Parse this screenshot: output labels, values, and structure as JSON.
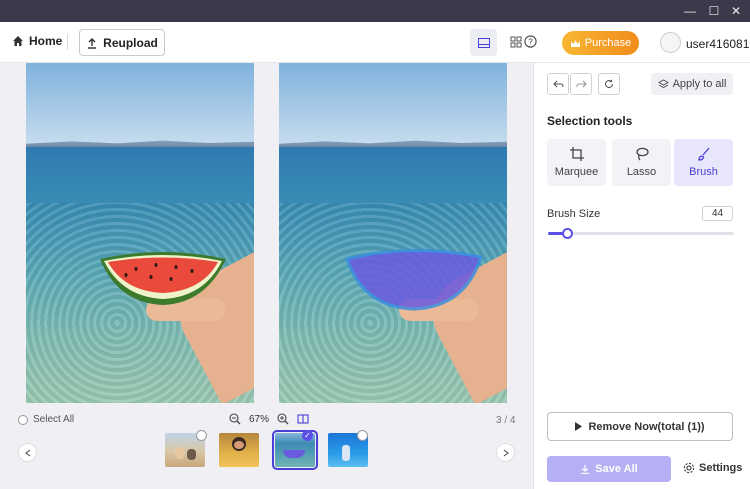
{
  "titlebar": {
    "minimize": "—",
    "maximize": "☐",
    "close": "✕"
  },
  "header": {
    "home_label": "Home",
    "reupload_label": "Reupload",
    "purchase_label": "Purchase",
    "username": "user416081"
  },
  "canvas": {
    "select_all_label": "Select All",
    "zoom_level": "67%",
    "page_counter": "3 / 4",
    "thumbnails": [
      {
        "name": "thumb-people-beach",
        "selected": false
      },
      {
        "name": "thumb-person-desert",
        "selected": false
      },
      {
        "name": "thumb-watermelon-sea",
        "selected": true
      },
      {
        "name": "thumb-diver-underwater",
        "selected": false
      }
    ]
  },
  "panel": {
    "apply_to_all_label": "Apply to all",
    "section_title": "Selection tools",
    "tools": [
      {
        "label": "Marquee",
        "icon": "crop-icon",
        "active": false
      },
      {
        "label": "Lasso",
        "icon": "lasso-icon",
        "active": false
      },
      {
        "label": "Brush",
        "icon": "brush-icon",
        "active": true
      }
    ],
    "brush_size_label": "Brush Size",
    "brush_size_value": "44",
    "brush_size_fraction": 0.1,
    "remove_label": "Remove Now(total (1))",
    "save_all_label": "Save All",
    "settings_label": "Settings"
  },
  "colors": {
    "accent": "#5b50e6",
    "save_button": "#b5aff3",
    "purchase_gradient_start": "#f7b733",
    "purchase_gradient_end": "#f28c1b",
    "titlebar": "#3a3a4a",
    "selection_overlay": "#6a5ae0"
  }
}
